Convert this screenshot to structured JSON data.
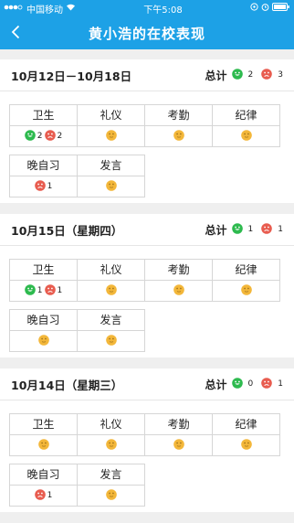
{
  "status_bar": {
    "carrier": "中国移动",
    "time": "下午5:08"
  },
  "nav": {
    "title": "黄小浩的在校表现"
  },
  "colors": {
    "primary": "#1da1e6",
    "good": "#2dba4e",
    "bad": "#e85c4f",
    "neutral": "#f3b73a"
  },
  "sections": [
    {
      "date": "10月12日－10月18日",
      "summary_label": "总计",
      "good_count": "2",
      "bad_count": "3",
      "row1": [
        {
          "label": "卫生",
          "good": "2",
          "bad": "2"
        },
        {
          "label": "礼仪"
        },
        {
          "label": "考勤"
        },
        {
          "label": "纪律"
        }
      ],
      "row2": [
        {
          "label": "晚自习",
          "bad": "1"
        },
        {
          "label": "发言"
        }
      ]
    },
    {
      "date": "10月15日（星期四）",
      "summary_label": "总计",
      "good_count": "1",
      "bad_count": "1",
      "row1": [
        {
          "label": "卫生",
          "good": "1",
          "bad": "1"
        },
        {
          "label": "礼仪"
        },
        {
          "label": "考勤"
        },
        {
          "label": "纪律"
        }
      ],
      "row2": [
        {
          "label": "晚自习"
        },
        {
          "label": "发言"
        }
      ]
    },
    {
      "date": "10月14日（星期三）",
      "summary_label": "总计",
      "good_count": "0",
      "bad_count": "1",
      "row1": [
        {
          "label": "卫生"
        },
        {
          "label": "礼仪"
        },
        {
          "label": "考勤"
        },
        {
          "label": "纪律"
        }
      ],
      "row2": [
        {
          "label": "晚自习",
          "bad": "1"
        },
        {
          "label": "发言"
        }
      ]
    }
  ]
}
